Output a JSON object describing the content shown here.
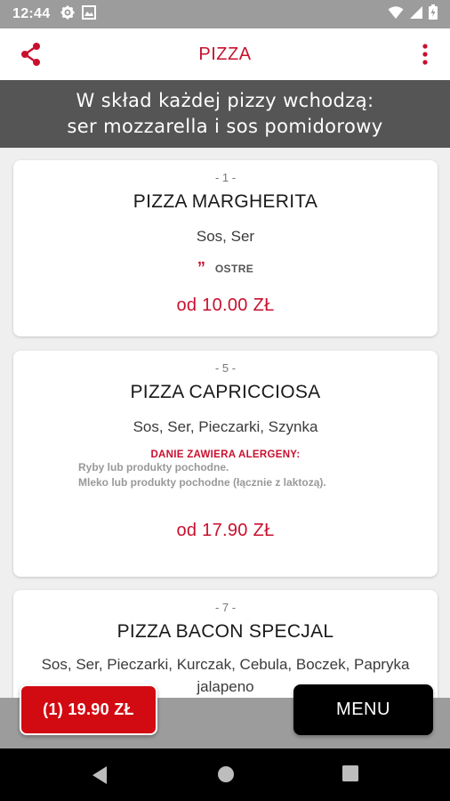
{
  "status": {
    "time": "12:44",
    "icons": [
      "settings-icon",
      "image-icon",
      "wifi-icon",
      "signal-icon",
      "battery-icon"
    ]
  },
  "appbar": {
    "title": "PIZZA",
    "accent": "#c8102e"
  },
  "banner": {
    "line1": "W skład każdej pizzy wchodzą:",
    "line2": "ser mozzarella i sos pomidorowy"
  },
  "cards": [
    {
      "number": "- 1 -",
      "name": "PIZZA MARGHERITA",
      "ingredients": "Sos, Ser",
      "spicy_mark": "”",
      "spicy_label": "OSTRE",
      "price": "od 10.00 ZŁ"
    },
    {
      "number": "- 5 -",
      "name": "PIZZA CAPRICCIOSA",
      "ingredients": "Sos, Ser, Pieczarki, Szynka",
      "allergens_head": "DANIE ZAWIERA ALERGENY:",
      "allergens": [
        "Ryby lub produkty pochodne.",
        "Mleko lub produkty pochodne (łącznie z laktozą)."
      ],
      "price": "od 17.90 ZŁ"
    },
    {
      "number": "- 7 -",
      "name": "PIZZA BACON SPECJAL",
      "ingredients": "Sos, Ser, Pieczarki, Kurczak, Cebula, Boczek, Papryka jalapeno"
    }
  ],
  "cart_button": "(1) 19.90 ZŁ",
  "menu_button": "MENU"
}
